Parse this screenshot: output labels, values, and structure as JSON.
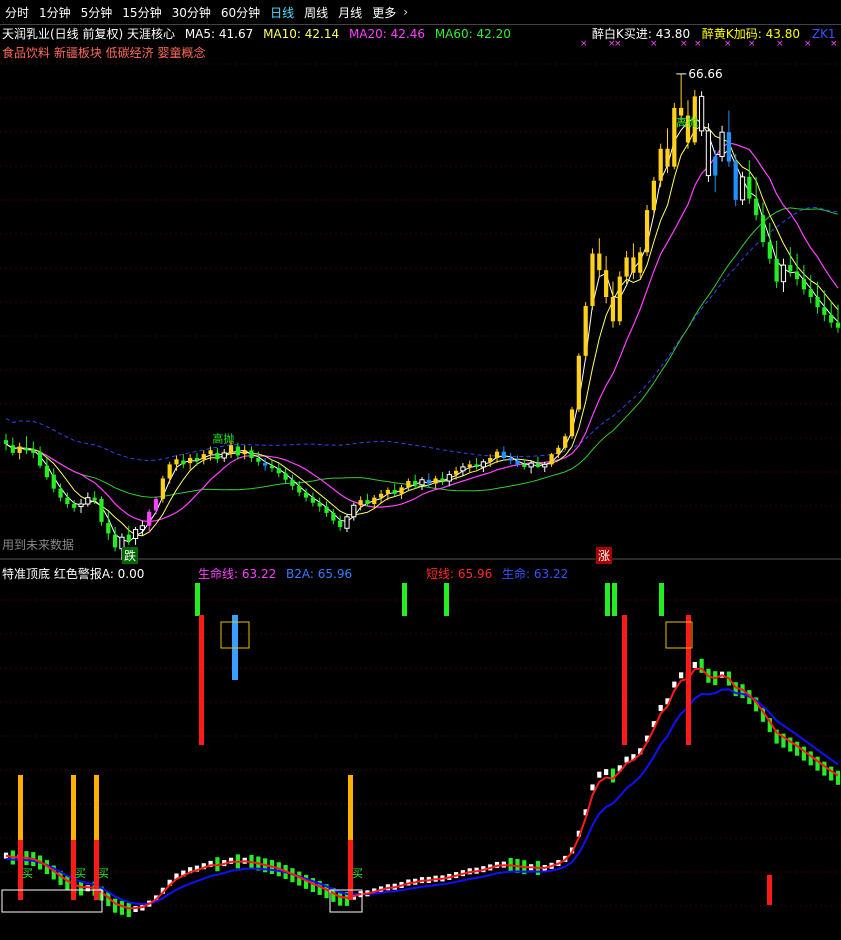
{
  "toolbar": {
    "tabs": [
      {
        "label": "分时"
      },
      {
        "label": "1分钟"
      },
      {
        "label": "5分钟"
      },
      {
        "label": "15分钟"
      },
      {
        "label": "30分钟"
      },
      {
        "label": "60分钟"
      },
      {
        "label": "日线"
      },
      {
        "label": "周线"
      },
      {
        "label": "月线"
      },
      {
        "label": "更多"
      }
    ],
    "active_index": 6,
    "more_chevron": "›"
  },
  "main_header": {
    "stock": "天润乳业(日线 前复权) 天涯核心",
    "ma5": "MA5: 41.67",
    "ma10": "MA10: 42.14",
    "ma20": "MA20: 42.46",
    "ma60": "MA60: 42.20",
    "buy_label": "醉白K买进: 43.80",
    "add_label": "醉黄K加码: 43.80",
    "zk_label": "ZK1",
    "concepts": "食品饮料 新疆板块 低碳经济 婴童概念",
    "future_note": "用到未来数据",
    "high_label": "66.66",
    "anno_gaopao1": "高抛",
    "anno_gaopao2": "高抛",
    "die_label": "跌",
    "zhang_label": "涨"
  },
  "sub_header": {
    "title": "特准顶底 红色警报A: 0.00",
    "lifeline": "生命线: 63.22",
    "b2a": "B2A: 65.96",
    "short": "短线: 65.96",
    "life": "生命: 63.22",
    "buy_marks": [
      "买",
      "买",
      "买",
      "买"
    ]
  },
  "colors": {
    "up_yellow": "#ffd11a",
    "down_green": "#22ee22",
    "hollow_white": "#ffffff",
    "blue_bar": "#1e90ff",
    "magenta": "#ff40ff",
    "ma_white": "#ffffff",
    "ma_yellow": "#ffff66",
    "ma60_green": "#33cc33",
    "dash_blue": "#3344ee",
    "red": "#ff1a1a",
    "orange": "#ffb000",
    "sub_blue": "#1010ff"
  },
  "chart_data": {
    "type": "candlestick",
    "title": "天润乳业(日线 前复权)",
    "price_range": [
      33,
      69
    ],
    "candles": [
      [
        38.0,
        38.5,
        37.2,
        37.7,
        "G"
      ],
      [
        37.6,
        38.2,
        36.8,
        37.0,
        "G"
      ],
      [
        37.0,
        37.8,
        36.5,
        37.5,
        "Y"
      ],
      [
        37.4,
        38.3,
        36.9,
        37.2,
        "G"
      ],
      [
        37.3,
        37.9,
        36.6,
        37.0,
        "G"
      ],
      [
        37.1,
        37.5,
        35.8,
        36.0,
        "G"
      ],
      [
        36.0,
        36.6,
        34.9,
        35.1,
        "G"
      ],
      [
        35.3,
        35.8,
        33.9,
        34.2,
        "G"
      ],
      [
        34.2,
        34.6,
        33.2,
        33.5,
        "G"
      ],
      [
        33.5,
        33.9,
        32.7,
        33.0,
        "G"
      ],
      [
        33.0,
        33.3,
        32.4,
        32.7,
        "G"
      ],
      [
        32.8,
        33.4,
        32.3,
        33.0,
        "W"
      ],
      [
        33.0,
        33.9,
        32.8,
        33.5,
        "W"
      ],
      [
        33.5,
        34.0,
        33.0,
        33.3,
        "G"
      ],
      [
        33.4,
        33.6,
        31.3,
        31.6,
        "G"
      ],
      [
        31.5,
        32.4,
        30.2,
        30.7,
        "G"
      ],
      [
        30.6,
        31.2,
        29.3,
        29.6,
        "G"
      ],
      [
        29.5,
        30.7,
        28.0,
        30.4,
        "W"
      ],
      [
        30.6,
        31.3,
        29.8,
        30.1,
        "G"
      ],
      [
        30.3,
        31.2,
        29.8,
        31.0,
        "W"
      ],
      [
        31.0,
        31.7,
        30.5,
        31.3,
        "W"
      ],
      [
        31.3,
        32.6,
        30.8,
        32.4,
        "M"
      ],
      [
        32.5,
        33.6,
        32.2,
        33.4,
        "M"
      ],
      [
        33.4,
        35.2,
        33.1,
        35.0,
        "Y"
      ],
      [
        35.0,
        36.3,
        34.6,
        36.1,
        "Y"
      ],
      [
        36.1,
        36.8,
        35.6,
        36.5,
        "Y"
      ],
      [
        36.4,
        36.9,
        35.8,
        36.1,
        "G"
      ],
      [
        36.2,
        36.9,
        35.7,
        36.6,
        "Y"
      ],
      [
        36.6,
        37.0,
        36.0,
        36.4,
        "G"
      ],
      [
        36.5,
        37.2,
        36.1,
        36.9,
        "Y"
      ],
      [
        36.9,
        37.5,
        36.4,
        37.2,
        "Y"
      ],
      [
        37.0,
        37.4,
        36.2,
        36.5,
        "G"
      ],
      [
        36.6,
        37.3,
        36.3,
        37.0,
        "W"
      ],
      [
        37.0,
        38.0,
        36.6,
        37.6,
        "Y"
      ],
      [
        37.5,
        37.8,
        36.5,
        36.8,
        "G"
      ],
      [
        36.9,
        37.6,
        36.5,
        37.2,
        "Y"
      ],
      [
        37.2,
        37.5,
        36.3,
        36.6,
        "G"
      ],
      [
        36.6,
        37.1,
        36.0,
        36.3,
        "G"
      ],
      [
        36.2,
        36.6,
        35.6,
        36.0,
        "B"
      ],
      [
        36.0,
        36.5,
        35.5,
        35.8,
        "G"
      ],
      [
        35.8,
        36.2,
        35.1,
        35.4,
        "G"
      ],
      [
        35.4,
        35.8,
        34.6,
        34.9,
        "G"
      ],
      [
        34.9,
        35.3,
        34.1,
        34.4,
        "G"
      ],
      [
        34.4,
        34.8,
        33.6,
        33.9,
        "G"
      ],
      [
        33.9,
        34.2,
        33.2,
        33.5,
        "G"
      ],
      [
        33.5,
        33.9,
        32.8,
        33.1,
        "G"
      ],
      [
        33.1,
        33.5,
        32.4,
        32.8,
        "G"
      ],
      [
        32.8,
        33.2,
        32.0,
        32.3,
        "G"
      ],
      [
        32.3,
        32.6,
        31.4,
        31.7,
        "G"
      ],
      [
        31.7,
        32.1,
        30.9,
        31.2,
        "G"
      ],
      [
        31.1,
        32.2,
        30.8,
        32.0,
        "W"
      ],
      [
        32.0,
        33.1,
        31.7,
        32.9,
        "W"
      ],
      [
        32.9,
        33.6,
        32.5,
        33.3,
        "Y"
      ],
      [
        33.3,
        33.8,
        32.8,
        33.0,
        "G"
      ],
      [
        33.0,
        33.7,
        32.6,
        33.5,
        "Y"
      ],
      [
        33.5,
        34.1,
        33.1,
        33.8,
        "Y"
      ],
      [
        33.8,
        34.3,
        33.3,
        34.1,
        "Y"
      ],
      [
        34.1,
        34.6,
        33.6,
        33.8,
        "G"
      ],
      [
        33.8,
        34.5,
        33.4,
        34.3,
        "Y"
      ],
      [
        34.3,
        35.0,
        34.0,
        34.8,
        "Y"
      ],
      [
        34.8,
        35.3,
        34.2,
        34.5,
        "G"
      ],
      [
        34.5,
        35.1,
        34.1,
        34.9,
        "W"
      ],
      [
        34.9,
        35.4,
        34.3,
        34.6,
        "B"
      ],
      [
        34.6,
        35.2,
        34.2,
        35.0,
        "Y"
      ],
      [
        35.0,
        35.5,
        34.5,
        34.8,
        "G"
      ],
      [
        34.8,
        35.6,
        34.4,
        35.3,
        "W"
      ],
      [
        35.3,
        35.9,
        34.9,
        35.6,
        "Y"
      ],
      [
        35.6,
        36.2,
        35.2,
        35.9,
        "W"
      ],
      [
        35.9,
        36.4,
        35.5,
        36.1,
        "Y"
      ],
      [
        36.1,
        36.6,
        35.7,
        35.9,
        "G"
      ],
      [
        35.9,
        36.5,
        35.5,
        36.3,
        "W"
      ],
      [
        36.3,
        36.9,
        35.9,
        36.6,
        "Y"
      ],
      [
        36.6,
        37.3,
        36.2,
        37.1,
        "Y"
      ],
      [
        37.1,
        37.5,
        36.4,
        36.6,
        "B"
      ],
      [
        36.6,
        37.0,
        36.1,
        36.4,
        "B"
      ],
      [
        36.4,
        36.8,
        35.9,
        36.1,
        "B"
      ],
      [
        36.1,
        36.5,
        35.7,
        35.9,
        "G"
      ],
      [
        35.9,
        36.4,
        35.4,
        36.2,
        "W"
      ],
      [
        36.2,
        36.7,
        35.8,
        35.9,
        "G"
      ],
      [
        35.9,
        36.3,
        35.5,
        36.1,
        "W"
      ],
      [
        36.1,
        37.0,
        35.9,
        36.9,
        "Y"
      ],
      [
        36.9,
        37.6,
        36.6,
        37.4,
        "Y"
      ],
      [
        37.4,
        38.5,
        37.2,
        38.3,
        "Y"
      ],
      [
        38.3,
        40.6,
        38.1,
        40.4,
        "Y"
      ],
      [
        40.4,
        44.8,
        40.2,
        44.6,
        "Y"
      ],
      [
        44.6,
        48.8,
        44.3,
        48.5,
        "Y"
      ],
      [
        48.5,
        53.0,
        48.2,
        52.6,
        "Y"
      ],
      [
        52.6,
        53.8,
        50.8,
        51.3,
        "Y"
      ],
      [
        51.3,
        52.4,
        48.7,
        49.2,
        "Y"
      ],
      [
        49.2,
        50.4,
        46.8,
        47.3,
        "Y"
      ],
      [
        47.3,
        51.2,
        47.0,
        50.8,
        "Y"
      ],
      [
        50.8,
        52.8,
        50.2,
        52.3,
        "Y"
      ],
      [
        52.3,
        53.4,
        50.6,
        51.1,
        "Y"
      ],
      [
        51.1,
        53.1,
        50.7,
        52.7,
        "Y"
      ],
      [
        52.7,
        56.4,
        52.4,
        56.0,
        "Y"
      ],
      [
        56.0,
        58.6,
        55.6,
        58.3,
        "Y"
      ],
      [
        58.3,
        61.2,
        57.8,
        60.8,
        "Y"
      ],
      [
        60.8,
        62.4,
        58.9,
        59.4,
        "Y"
      ],
      [
        59.4,
        64.4,
        59.2,
        64.0,
        "Y"
      ],
      [
        64.0,
        66.66,
        62.9,
        63.4,
        "Y"
      ],
      [
        63.4,
        64.6,
        60.8,
        61.3,
        "Y"
      ],
      [
        61.3,
        65.4,
        61.1,
        64.9,
        "Y"
      ],
      [
        64.9,
        65.3,
        61.8,
        62.2,
        "W"
      ],
      [
        62.2,
        62.8,
        58.2,
        58.7,
        "W"
      ],
      [
        58.7,
        60.7,
        57.4,
        60.2,
        "B"
      ],
      [
        60.2,
        62.6,
        59.8,
        62.1,
        "W"
      ],
      [
        62.1,
        63.8,
        59.4,
        59.8,
        "B"
      ],
      [
        59.8,
        60.4,
        56.3,
        56.8,
        "B"
      ],
      [
        56.8,
        59.0,
        56.4,
        58.6,
        "W"
      ],
      [
        58.6,
        59.9,
        56.5,
        56.9,
        "G"
      ],
      [
        56.9,
        58.6,
        55.2,
        55.6,
        "G"
      ],
      [
        55.6,
        56.6,
        53.1,
        53.5,
        "G"
      ],
      [
        53.5,
        55.0,
        51.8,
        52.2,
        "G"
      ],
      [
        52.2,
        53.6,
        49.9,
        50.4,
        "G"
      ],
      [
        50.4,
        52.2,
        49.6,
        51.7,
        "W"
      ],
      [
        51.7,
        53.1,
        50.8,
        51.2,
        "G"
      ],
      [
        51.2,
        52.6,
        50.1,
        50.6,
        "G"
      ],
      [
        50.6,
        51.7,
        49.4,
        49.8,
        "G"
      ],
      [
        49.8,
        50.9,
        48.7,
        49.2,
        "G"
      ],
      [
        49.2,
        50.4,
        47.9,
        48.4,
        "G"
      ],
      [
        48.4,
        49.7,
        47.3,
        47.8,
        "G"
      ],
      [
        47.8,
        48.9,
        46.8,
        47.2,
        "G"
      ],
      [
        47.2,
        48.6,
        46.4,
        46.8,
        "G"
      ]
    ],
    "ma_series": [
      {
        "name": "MA5",
        "value": 41.67
      },
      {
        "name": "MA10",
        "value": 42.14
      },
      {
        "name": "MA20",
        "value": 42.46
      },
      {
        "name": "MA60",
        "value": 42.2
      }
    ],
    "sub_panel": {
      "name": "特准顶底",
      "short_line": 65.96,
      "life_line": 63.22,
      "b2a": 65.96,
      "red_alert_a": 0.0
    }
  }
}
